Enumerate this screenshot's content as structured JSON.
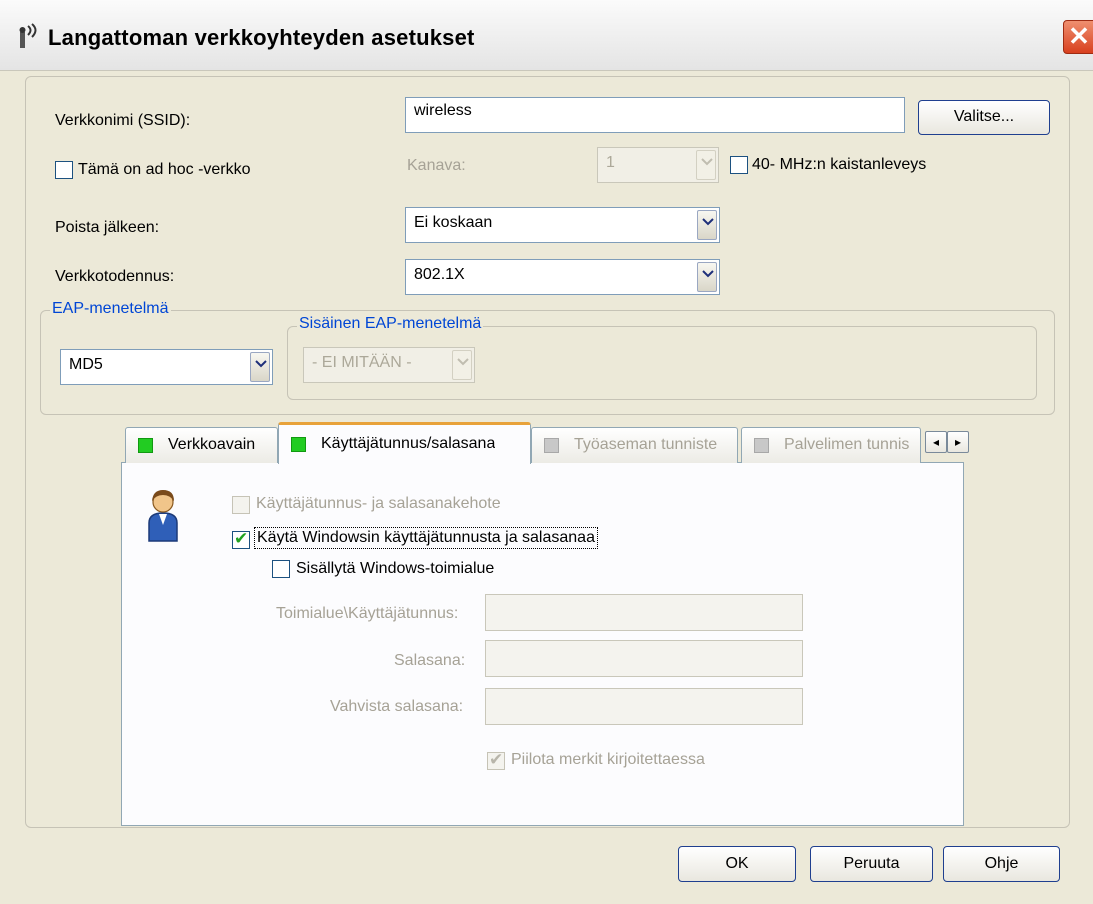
{
  "window": {
    "title": "Langattoman verkkoyhteyden asetukset",
    "close_glyph": "✕"
  },
  "ssid": {
    "label": "Verkkonimi (SSID):",
    "value": "wireless",
    "choose_button": "Valitse..."
  },
  "adhoc": {
    "label": "Tämä on ad hoc -verkko",
    "checked": false
  },
  "channel": {
    "label": "Kanava:",
    "value": "1"
  },
  "bandwidth": {
    "label": "40- MHz:n kaistanleveys",
    "checked": false
  },
  "delete_after": {
    "label": "Poista jälkeen:",
    "value": "Ei koskaan"
  },
  "auth": {
    "label": "Verkkotodennus:",
    "value": "802.1X"
  },
  "eap": {
    "legend": "EAP-menetelmä",
    "value": "MD5"
  },
  "inner_eap": {
    "legend": "Sisäinen EAP-menetelmä",
    "value": "- EI MITÄÄN -"
  },
  "tabs": [
    {
      "label": "Verkkoavain",
      "status_color": "#22cc22"
    },
    {
      "label": "Käyttäjätunnus/salasana",
      "status_color": "#22cc22"
    },
    {
      "label": "Työaseman tunniste",
      "status_color": "#c8c8c8"
    },
    {
      "label": "Palvelimen tunnis",
      "status_color": "#c8c8c8"
    }
  ],
  "tab_scroll": {
    "left": "◂",
    "right": "▸"
  },
  "credentials": {
    "prompt_label": "Käyttäjätunnus- ja salasanakehote",
    "use_windows_label": "Käytä Windowsin käyttäjätunnusta ja salasanaa",
    "include_domain_label": "Sisällytä Windows-toimialue",
    "domain_user_label": "Toimialue\\Käyttäjätunnus:",
    "password_label": "Salasana:",
    "confirm_password_label": "Vahvista salasana:",
    "hide_chars_label": "Piilota merkit kirjoitettaessa"
  },
  "buttons": {
    "ok": "OK",
    "cancel": "Peruuta",
    "help": "Ohje"
  },
  "icons": {
    "title": "wireless-signal-icon",
    "user": "user-icon"
  }
}
